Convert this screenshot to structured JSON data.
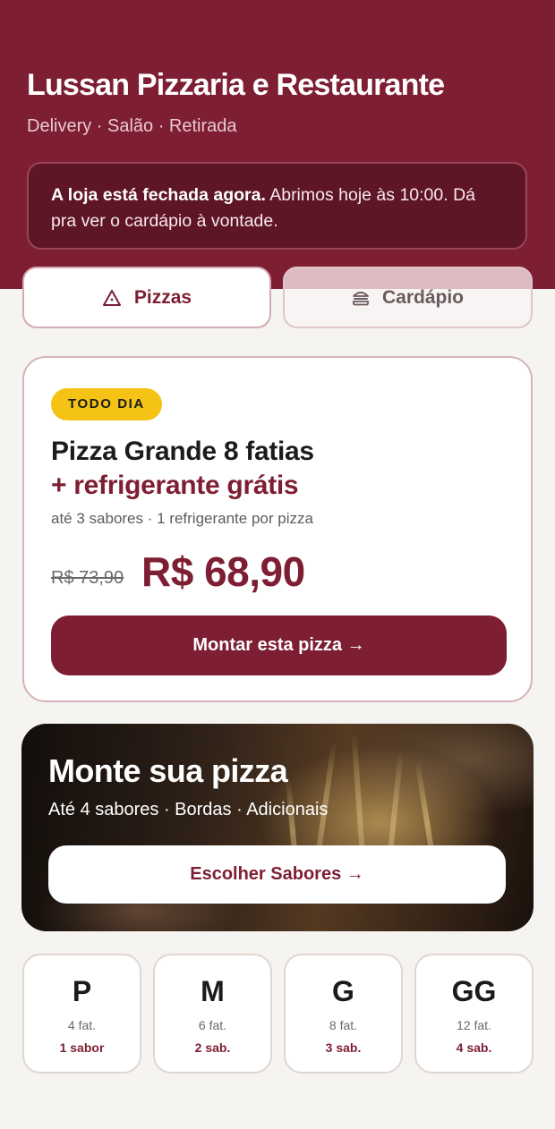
{
  "header": {
    "title": "Lussan Pizzaria e Restaurante",
    "subtitle": "Delivery · Salão · Retirada",
    "notice_bold": "A loja está fechada agora.",
    "notice_rest": " Abrimos hoje às 10:00. Dá pra ver o cardápio à vontade."
  },
  "tabs": [
    {
      "label": "Pizzas",
      "icon": "pizza-slice-icon",
      "active": true
    },
    {
      "label": "Cardápio",
      "icon": "burger-icon",
      "active": false
    }
  ],
  "promo": {
    "badge": "TODO DIA",
    "title_line1": "Pizza Grande 8 fatias",
    "title_line2": "+ refrigerante grátis",
    "details": "até 3 sabores · 1 refrigerante por pizza",
    "price_old": "R$ 73,90",
    "price_new": "R$ 68,90",
    "cta": "Montar esta pizza →"
  },
  "custom": {
    "title": "Monte sua pizza",
    "subtitle": "Até 4 sabores · Bordas · Adicionais",
    "cta": "Escolher Sabores →"
  },
  "sizes": [
    {
      "letter": "P",
      "slices": "4 fat.",
      "flavors": "1 sabor"
    },
    {
      "letter": "M",
      "slices": "6 fat.",
      "flavors": "2 sab."
    },
    {
      "letter": "G",
      "slices": "8 fat.",
      "flavors": "3 sab."
    },
    {
      "letter": "GG",
      "slices": "12 fat.",
      "flavors": "4 sab."
    }
  ],
  "colors": {
    "brand": "#7e1e33",
    "badge": "#f4c316",
    "background": "#f6f4f1"
  }
}
